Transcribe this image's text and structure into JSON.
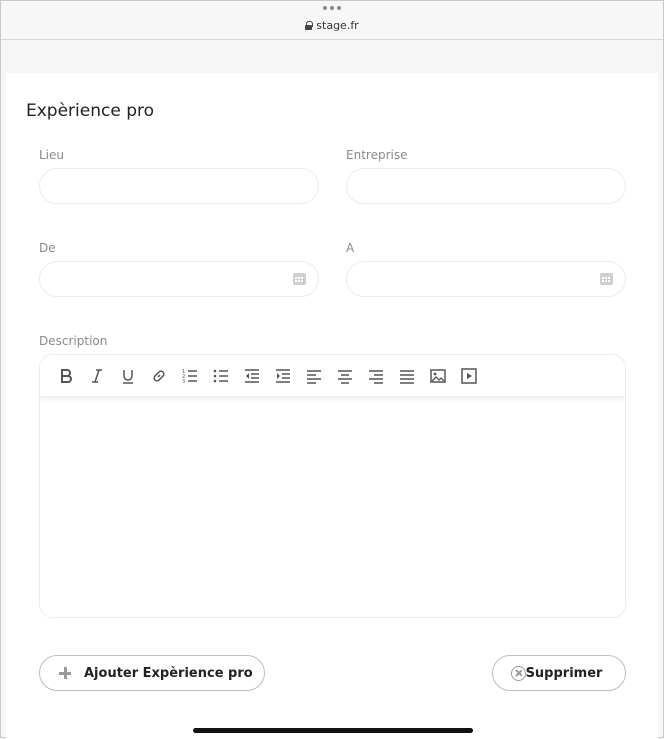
{
  "browser": {
    "url": "stage.fr"
  },
  "form": {
    "title": "Expèrience pro",
    "fields": {
      "lieu": {
        "label": "Lieu",
        "value": ""
      },
      "entreprise": {
        "label": "Entreprise",
        "value": ""
      },
      "de": {
        "label": "De",
        "value": ""
      },
      "a": {
        "label": "A",
        "value": ""
      },
      "description": {
        "label": "Description",
        "value": ""
      }
    },
    "toolbar": [
      "bold-icon",
      "italic-icon",
      "underline-icon",
      "link-icon",
      "ordered-list-icon",
      "bullet-list-icon",
      "outdent-icon",
      "indent-icon",
      "align-left-icon",
      "align-center-icon",
      "align-right-icon",
      "align-justify-icon",
      "image-icon",
      "video-icon"
    ],
    "buttons": {
      "add_label": "Ajouter Expèrience pro",
      "delete_label": "Supprimer"
    }
  }
}
